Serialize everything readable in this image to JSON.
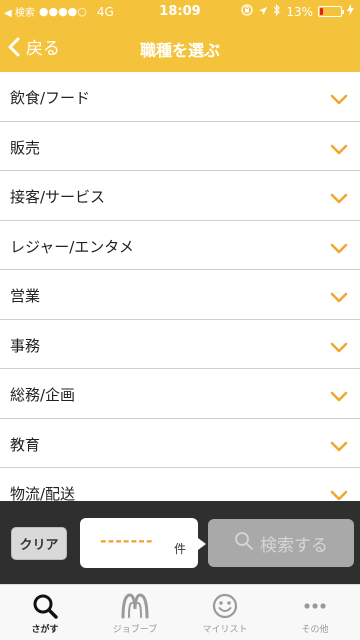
{
  "status_bar": {
    "back_app": "◀ 検索",
    "signal": "●●●●○",
    "carrier": "4G",
    "time": "18:09",
    "battery_text": "13%",
    "battery_level": 0.13,
    "battery_color": "#e02020"
  },
  "nav": {
    "back_label": "戻る",
    "title": "職種を選ぶ"
  },
  "list": {
    "items": [
      {
        "label": "飲食/フード"
      },
      {
        "label": "販売"
      },
      {
        "label": "接客/サービス"
      },
      {
        "label": "レジャー/エンタメ"
      },
      {
        "label": "営業"
      },
      {
        "label": "事務"
      },
      {
        "label": "総務/企画"
      },
      {
        "label": "教育"
      },
      {
        "label": "物流/配送"
      }
    ],
    "chevron_icon": "chevron-down-icon",
    "chevron_color": "#f0a830"
  },
  "toolbar": {
    "clear_label": "クリア",
    "count_value": "-------",
    "count_unit": "件",
    "search_label": "検索する"
  },
  "tabs": [
    {
      "label": "さがす",
      "icon": "search-icon",
      "active": true
    },
    {
      "label": "ジョブーブ",
      "icon": "jobuubu-logo-icon",
      "active": false
    },
    {
      "label": "マイリスト",
      "icon": "smiley-icon",
      "active": false
    },
    {
      "label": "その他",
      "icon": "more-dots-icon",
      "active": false
    }
  ],
  "colors": {
    "brand": "#f5c33b",
    "toolbar_bg": "#2f2f2f",
    "count_accent": "#f0a030"
  }
}
